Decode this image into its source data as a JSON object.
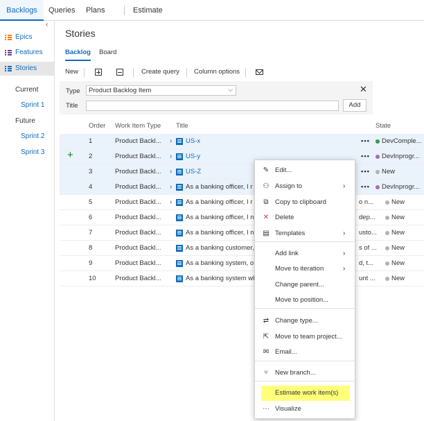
{
  "topnav": {
    "tabs": [
      "Backlogs",
      "Queries",
      "Plans",
      "Estimate"
    ]
  },
  "sidebar": {
    "collapse_glyph": "‹",
    "items": [
      {
        "label": "Epics",
        "icon": "epic-icon",
        "color": "#ff7b00"
      },
      {
        "label": "Features",
        "icon": "feature-icon",
        "color": "#773b93"
      },
      {
        "label": "Stories",
        "icon": "story-icon",
        "color": "#0f6cbd"
      }
    ],
    "current_heading": "Current",
    "current_sprints": [
      "Sprint 1"
    ],
    "future_heading": "Future",
    "future_sprints": [
      "Sprint 2",
      "Sprint 3"
    ]
  },
  "main": {
    "title": "Stories",
    "pivots": [
      "Backlog",
      "Board"
    ],
    "toolbar": {
      "new_label": "New",
      "expand_icon": "expand-all-icon",
      "collapse_icon": "collapse-all-icon",
      "create_query_label": "Create query",
      "column_options_label": "Column options",
      "email_icon": "mail-icon"
    },
    "add_panel": {
      "type_label": "Type",
      "type_value": "Product Backlog Item",
      "title_label": "Title",
      "title_value": "",
      "add_label": "Add"
    },
    "columns": [
      "Order",
      "Work Item Type",
      "Title",
      "State"
    ],
    "rows": [
      {
        "order": "1",
        "type": "Product Backl...",
        "title": "US-x",
        "state": "DevComple...",
        "state_color": "#339947",
        "expand": "›",
        "highlight": true,
        "more": "•••"
      },
      {
        "order": "2",
        "type": "Product Backl...",
        "title": "US-y",
        "state": "DevInprogr...",
        "state_color": "#a66bbf",
        "expand": "›",
        "highlight": true,
        "more": "•••"
      },
      {
        "order": "3",
        "type": "Product Backl...",
        "title": "US-Z",
        "state": "New",
        "state_color": "#b2b2b2",
        "expand": "›",
        "highlight": true,
        "more": "•••"
      },
      {
        "order": "4",
        "type": "Product Backl...",
        "title": "As a banking officer, I r",
        "state": "DevInprogr...",
        "state_color": "#a66bbf",
        "expand": "›",
        "highlight": true,
        "more": "•••"
      },
      {
        "order": "5",
        "type": "Product Backl...",
        "title": "As a banking officer, I r",
        "title_tail": "o n...",
        "state": "New",
        "state_color": "#b2b2b2",
        "expand": "›",
        "highlight": false,
        "more": ""
      },
      {
        "order": "6",
        "type": "Product Backl...",
        "title": "As a banking officer, I n",
        "title_tail": "dep...",
        "state": "New",
        "state_color": "#b2b2b2",
        "expand": "",
        "highlight": false,
        "more": ""
      },
      {
        "order": "7",
        "type": "Product Backl...",
        "title": "As a banking officer, I n",
        "title_tail": "usto...",
        "state": "New",
        "state_color": "#b2b2b2",
        "expand": "",
        "highlight": false,
        "more": ""
      },
      {
        "order": "8",
        "type": "Product Backl...",
        "title": "As a banking customer,",
        "title_tail": "s of ...",
        "state": "New",
        "state_color": "#b2b2b2",
        "expand": "",
        "highlight": false,
        "more": ""
      },
      {
        "order": "9",
        "type": "Product Backl...",
        "title": "As a banking system, o",
        "title_tail": "d, t...",
        "state": "New",
        "state_color": "#b2b2b2",
        "expand": "",
        "highlight": false,
        "more": ""
      },
      {
        "order": "10",
        "type": "Product Backl...",
        "title": "As a banking system wl",
        "title_tail": "unt ...",
        "state": "New",
        "state_color": "#b2b2b2",
        "expand": "",
        "highlight": false,
        "more": ""
      }
    ],
    "add_row_icon": "+"
  },
  "context_menu": {
    "items": [
      {
        "label": "Edit...",
        "icon": "edit-icon",
        "glyph": "✎",
        "submenu": false
      },
      {
        "label": "Assign to",
        "icon": "assign-icon",
        "glyph": "⚇",
        "submenu": true
      },
      {
        "label": "Copy to clipboard",
        "icon": "copy-icon",
        "glyph": "⧉",
        "submenu": false
      },
      {
        "label": "Delete",
        "icon": "delete-icon",
        "glyph": "✕",
        "submenu": false,
        "glyph_color": "#d13438"
      },
      {
        "label": "Templates",
        "icon": "templates-icon",
        "glyph": "▤",
        "submenu": true
      },
      {
        "label": "Add link",
        "icon": "",
        "glyph": "",
        "submenu": true
      },
      {
        "label": "Move to iteration",
        "icon": "",
        "glyph": "",
        "submenu": true
      },
      {
        "label": "Change parent...",
        "icon": "",
        "glyph": "",
        "submenu": false
      },
      {
        "label": "Move to position...",
        "icon": "",
        "glyph": "",
        "submenu": false
      },
      {
        "label": "Change type...",
        "icon": "change-type-icon",
        "glyph": "⇄",
        "submenu": false
      },
      {
        "label": "Move to team project...",
        "icon": "move-project-icon",
        "glyph": "⇱",
        "submenu": false
      },
      {
        "label": "Email...",
        "icon": "email-icon",
        "glyph": "✉",
        "submenu": false
      },
      {
        "label": "New branch...",
        "icon": "branch-icon",
        "glyph": "⑂",
        "submenu": false
      },
      {
        "label": "Estimate work item(s)",
        "icon": "",
        "glyph": "",
        "submenu": false,
        "highlight": true
      },
      {
        "label": "Visualize",
        "icon": "visualize-icon",
        "glyph": "⋯",
        "submenu": false
      }
    ],
    "submenu_glyph": "›"
  },
  "colors": {
    "accent": "#0f6cbd",
    "highlight_row": "#eaf2fb",
    "menu_highlight": "#ffff7a"
  }
}
